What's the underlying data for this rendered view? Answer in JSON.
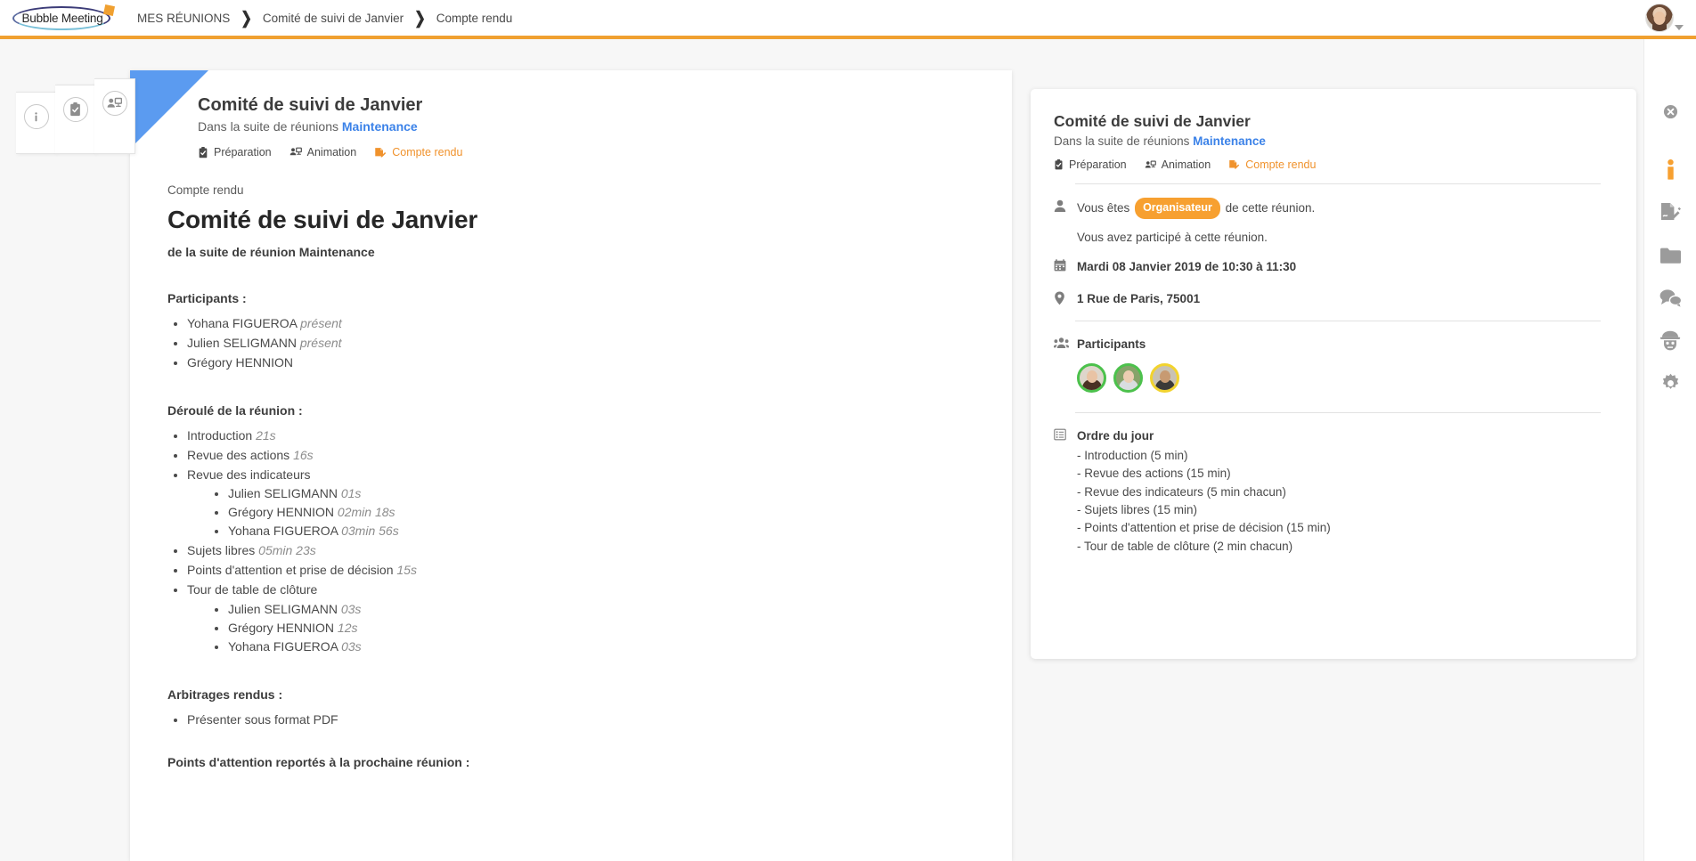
{
  "app": {
    "logo_text": "Bubble Meeting"
  },
  "breadcrumb": {
    "items": [
      {
        "label": "MES RÉUNIONS"
      },
      {
        "label": "Comité de suivi de Janvier"
      },
      {
        "label": "Compte rendu"
      }
    ],
    "separator": "❯"
  },
  "user_menu": {
    "avatar_name": "user-avatar",
    "caret": "chevron-down-icon"
  },
  "side_tabs": [
    {
      "icon": "info-icon",
      "name": "sidebar-tab-informations"
    },
    {
      "icon": "clipboard-check-icon",
      "name": "sidebar-tab-preparation"
    },
    {
      "icon": "presentation-icon",
      "name": "sidebar-tab-animation"
    }
  ],
  "document_header": {
    "title": "Comité de suivi de Janvier",
    "subtitle_prefix": "Dans la suite de réunions",
    "subtitle_link": "Maintenance",
    "tabs": [
      {
        "label": "Préparation",
        "icon": "clipboard-check-icon",
        "active": false
      },
      {
        "label": "Animation",
        "icon": "presentation-icon",
        "active": false
      },
      {
        "label": "Compte rendu",
        "icon": "edit-document-icon",
        "active": true
      }
    ]
  },
  "report": {
    "kicker": "Compte rendu",
    "title": "Comité de suivi de Janvier",
    "subtitle": "de la suite de réunion Maintenance",
    "participants_heading": "Participants :",
    "participants": [
      {
        "name": "Yohana FIGUEROA",
        "status": "présent"
      },
      {
        "name": "Julien SELIGMANN",
        "status": "présent"
      },
      {
        "name": "Grégory HENNION",
        "status": ""
      }
    ],
    "agenda_heading": "Déroulé de la réunion :",
    "agenda": [
      {
        "label": "Introduction",
        "duration": "21s",
        "children": []
      },
      {
        "label": "Revue des actions",
        "duration": "16s",
        "children": []
      },
      {
        "label": "Revue des indicateurs",
        "duration": "",
        "children": [
          {
            "label": "Julien SELIGMANN",
            "duration": "01s"
          },
          {
            "label": "Grégory HENNION",
            "duration": "02min 18s"
          },
          {
            "label": "Yohana FIGUEROA",
            "duration": "03min 56s"
          }
        ]
      },
      {
        "label": "Sujets libres",
        "duration": "05min 23s",
        "children": []
      },
      {
        "label": "Points d'attention et prise de décision",
        "duration": "15s",
        "children": []
      },
      {
        "label": "Tour de table de clôture",
        "duration": "",
        "children": [
          {
            "label": "Julien SELIGMANN",
            "duration": "03s"
          },
          {
            "label": "Grégory HENNION",
            "duration": "12s"
          },
          {
            "label": "Yohana FIGUEROA",
            "duration": "03s"
          }
        ]
      }
    ],
    "arbitrations_heading": "Arbitrages rendus :",
    "arbitrations": [
      {
        "label": "Présenter sous format PDF"
      }
    ],
    "postponed_heading": "Points d'attention reportés à la prochaine réunion :"
  },
  "info_panel": {
    "title": "Comité de suivi de Janvier",
    "subtitle_prefix": "Dans la suite de réunions",
    "subtitle_link": "Maintenance",
    "tabs": [
      {
        "label": "Préparation",
        "icon": "clipboard-check-icon",
        "active": false
      },
      {
        "label": "Animation",
        "icon": "presentation-icon",
        "active": false
      },
      {
        "label": "Compte rendu",
        "icon": "edit-document-icon",
        "active": true
      }
    ],
    "role_prefix": "Vous êtes",
    "role_badge": "Organisateur",
    "role_suffix": "de cette réunion.",
    "attendance": "Vous avez participé à cette réunion.",
    "datetime": "Mardi 08 Janvier 2019 de 10:30 à 11:30",
    "location": "1 Rue de Paris, 75001",
    "participants_label": "Participants",
    "participants": [
      {
        "name": "Yohana FIGUEROA",
        "ring": "#4cc14c"
      },
      {
        "name": "Julien SELIGMANN",
        "ring": "#4cc14c"
      },
      {
        "name": "Grégory HENNION",
        "ring": "#f2d32e"
      }
    ],
    "agenda_label": "Ordre du jour",
    "agenda_lines": [
      "- Introduction (5 min)",
      "- Revue des actions (15 min)",
      "- Revue des indicateurs (5 min chacun)",
      "- Sujets libres (15 min)",
      "- Points d'attention et prise de décision (15 min)",
      "- Tour de table de clôture (2 min chacun)"
    ]
  },
  "rail": {
    "items": [
      {
        "icon": "close-circle-icon",
        "name": "close-panel-button",
        "active": false
      },
      {
        "icon": "info-icon",
        "name": "rail-informations",
        "active": true
      },
      {
        "icon": "edit-document-icon",
        "name": "rail-compte-rendu",
        "active": false
      },
      {
        "icon": "folder-icon",
        "name": "rail-documents",
        "active": false
      },
      {
        "icon": "chat-bubbles-icon",
        "name": "rail-discussions",
        "active": false
      },
      {
        "icon": "spy-icon",
        "name": "rail-anonymous",
        "active": false
      },
      {
        "icon": "gear-icon",
        "name": "rail-settings",
        "active": false
      }
    ]
  },
  "colors": {
    "accent_orange": "#f0a030",
    "link_blue": "#3b82e8",
    "corner_blue": "#5b9bf0",
    "badge_orange": "#f7a030"
  }
}
